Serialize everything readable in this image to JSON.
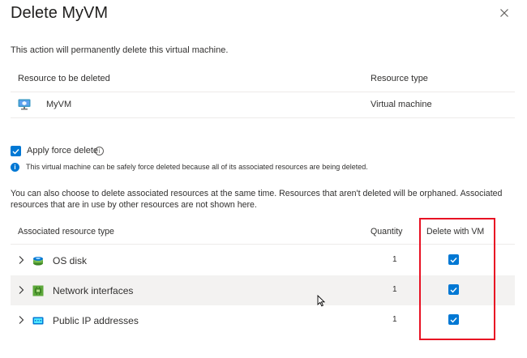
{
  "dialog": {
    "title": "Delete MyVM",
    "description": "This action will permanently delete this virtual machine."
  },
  "resource_table": {
    "col_resource": "Resource to be deleted",
    "col_type": "Resource type",
    "row": {
      "name": "MyVM",
      "type": "Virtual machine",
      "icon": "virtual-machine-icon"
    }
  },
  "force_delete": {
    "label": "Apply force delete",
    "checked": true,
    "info": "This virtual machine can be safely force deleted because all of its associated resources are being deleted."
  },
  "associated": {
    "paragraph": "You can also choose to delete associated resources at the same time. Resources that aren't deleted will be orphaned. Associated resources that are in use by other resources are not shown here.",
    "col_type": "Associated resource type",
    "col_quantity": "Quantity",
    "col_delete": "Delete with VM",
    "rows": [
      {
        "name": "OS disk",
        "quantity": "1",
        "delete_with_vm": true,
        "icon": "disk-icon"
      },
      {
        "name": "Network interfaces",
        "quantity": "1",
        "delete_with_vm": true,
        "icon": "network-interface-icon"
      },
      {
        "name": "Public IP addresses",
        "quantity": "1",
        "delete_with_vm": true,
        "icon": "public-ip-icon"
      }
    ]
  },
  "colors": {
    "accent": "#0078d4",
    "highlight": "#e81123",
    "row_alt": "#f3f2f1"
  }
}
